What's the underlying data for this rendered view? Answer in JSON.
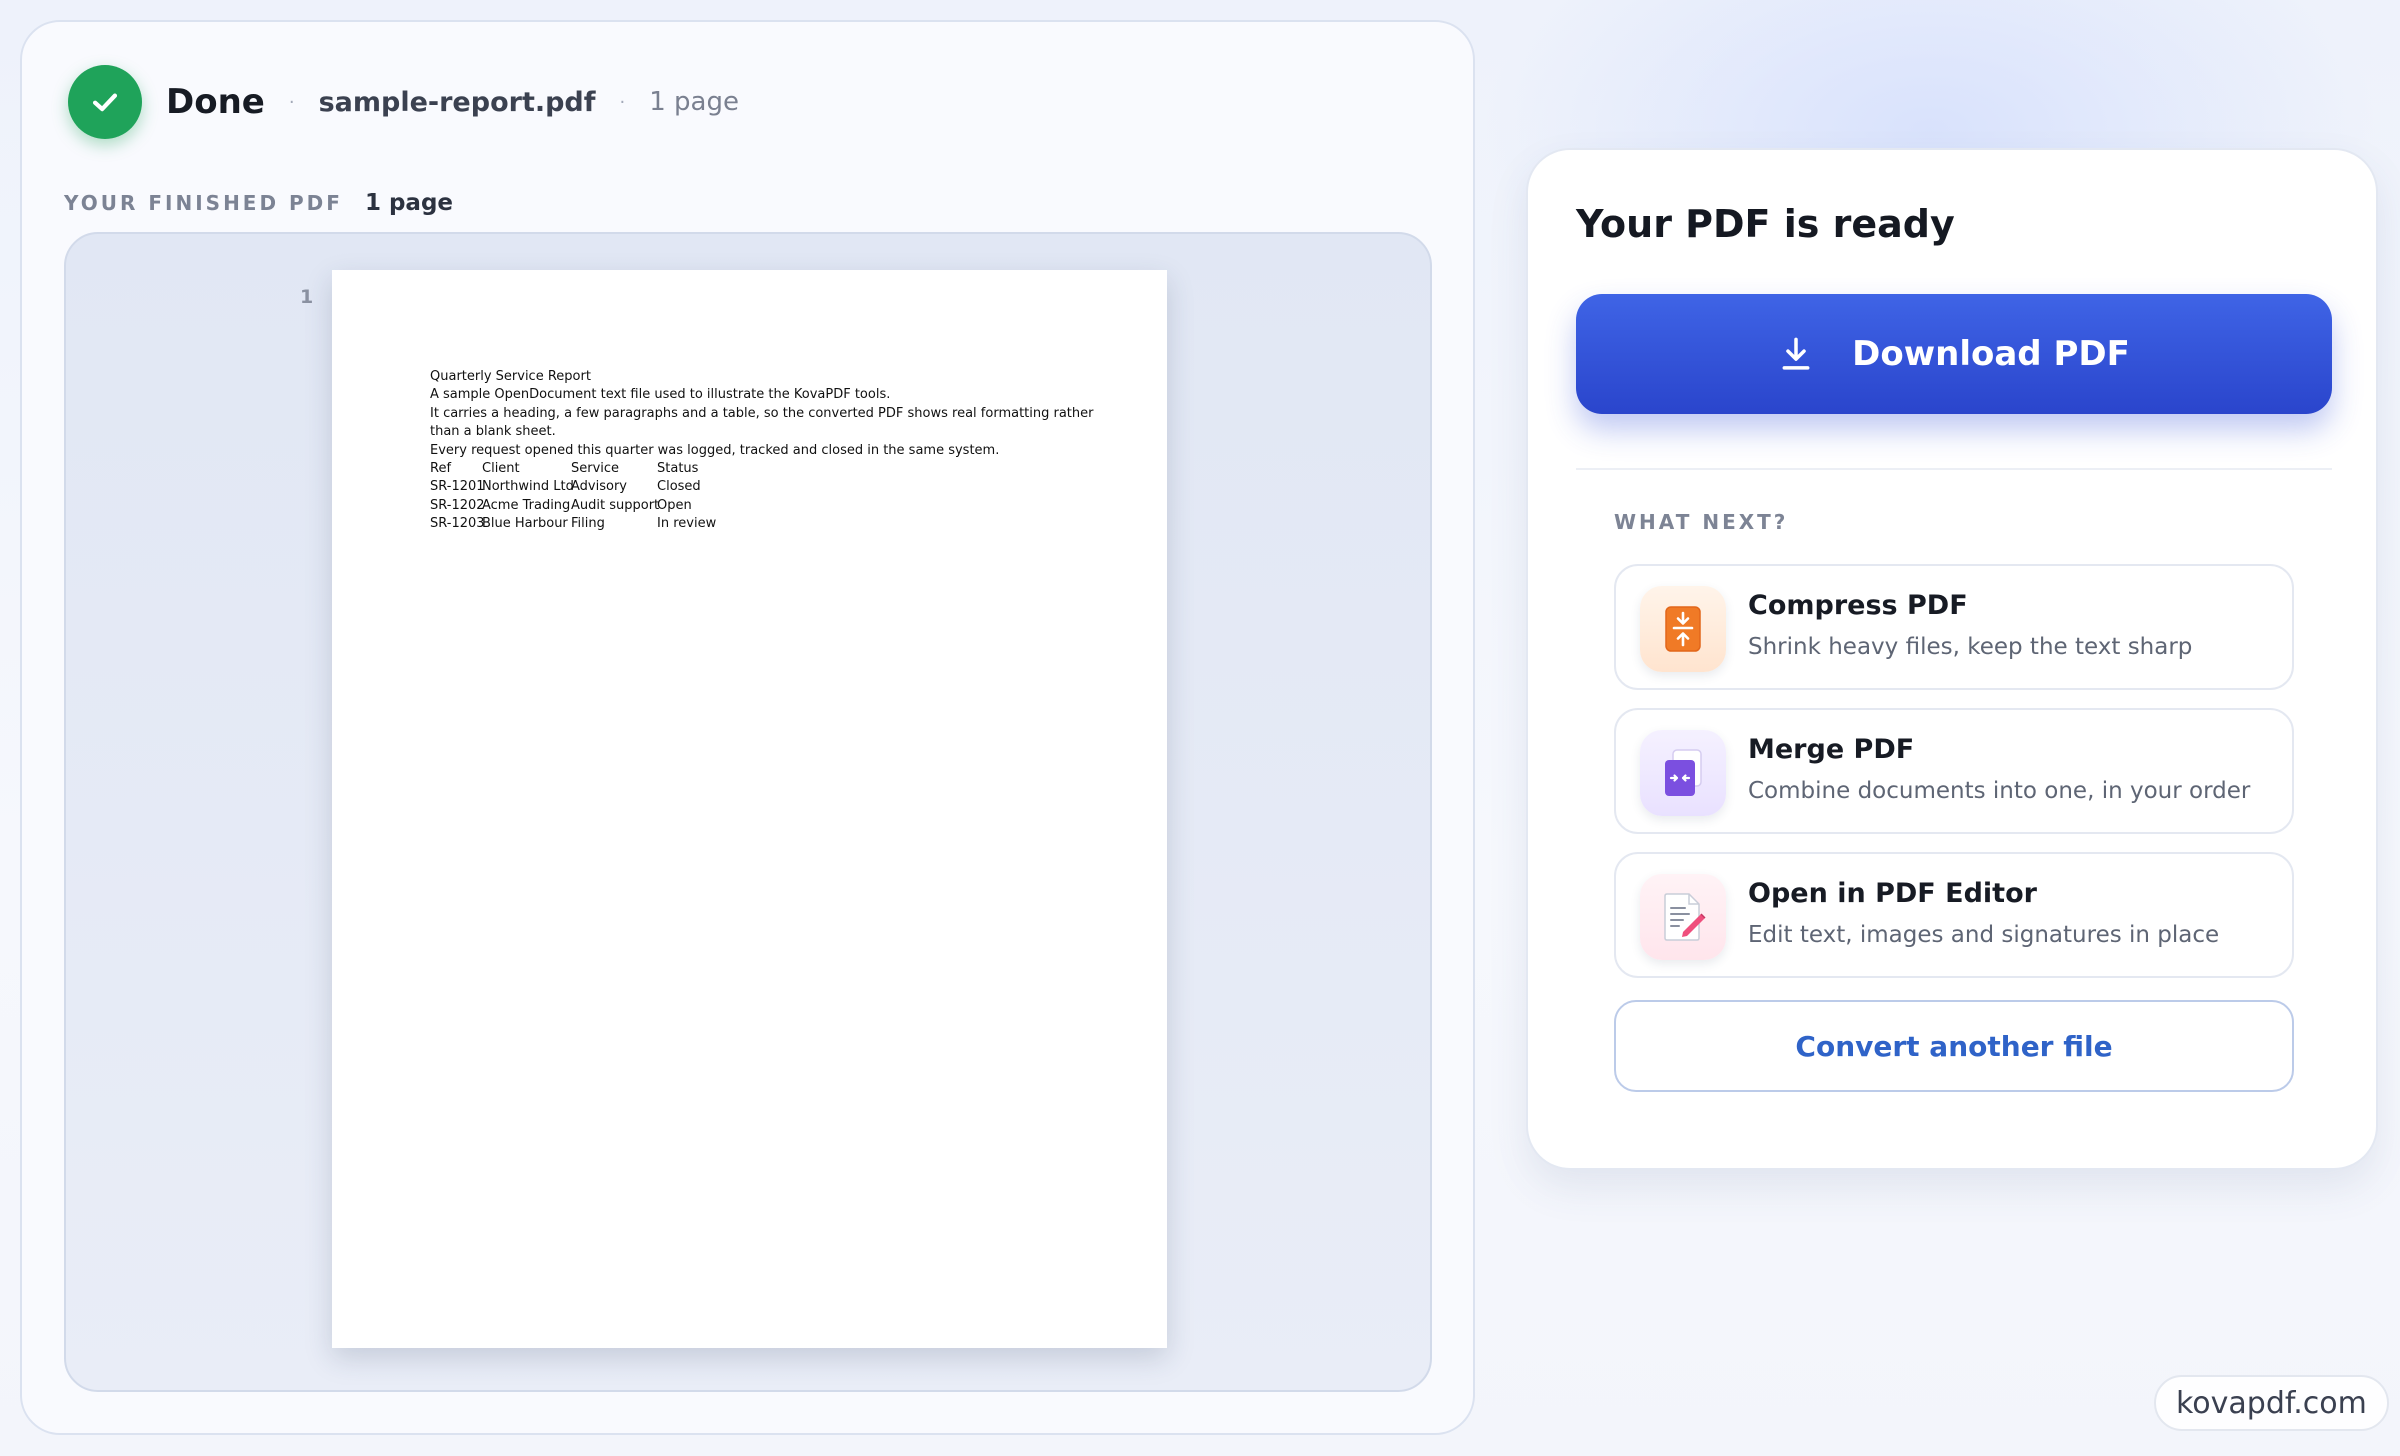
{
  "status": {
    "done_label": "Done",
    "file_name": "sample-report.pdf",
    "page_count": "1 page"
  },
  "finished": {
    "label": "YOUR FINISHED PDF",
    "pages": "1 page"
  },
  "preview": {
    "page_number": "1",
    "document": {
      "lines": [
        "Quarterly Service Report",
        "A sample OpenDocument text file used to illustrate the KovaPDF tools.",
        "It carries a heading, a few paragraphs and a table, so the converted PDF shows real formatting rather",
        "than a blank sheet.",
        "Every request opened this quarter was logged, tracked and closed in the same system."
      ],
      "table": {
        "headers": [
          "Ref",
          "Client",
          "Service",
          "Status"
        ],
        "rows": [
          [
            "SR-1201",
            "Northwind Ltd",
            "Advisory",
            "Closed"
          ],
          [
            "SR-1202",
            "Acme Trading",
            "Audit support",
            "Open"
          ],
          [
            "SR-1203",
            "Blue Harbour",
            "Filing",
            "In review"
          ]
        ]
      }
    }
  },
  "ready_card": {
    "title": "Your PDF is ready",
    "download_label": "Download PDF",
    "what_next_label": "WHAT NEXT?",
    "items": [
      {
        "title": "Compress PDF",
        "description": "Shrink heavy files, keep the text sharp",
        "icon": "compress-icon"
      },
      {
        "title": "Merge PDF",
        "description": "Combine documents into one, in your order",
        "icon": "merge-icon"
      },
      {
        "title": "Open in PDF Editor",
        "description": "Edit text, images and signatures in place",
        "icon": "edit-icon"
      }
    ],
    "convert_label": "Convert another file"
  },
  "watermark": "kovapdf.com",
  "colors": {
    "success": "#1fa35a",
    "primary": "#2f4fd8",
    "link": "#2f63c8"
  }
}
